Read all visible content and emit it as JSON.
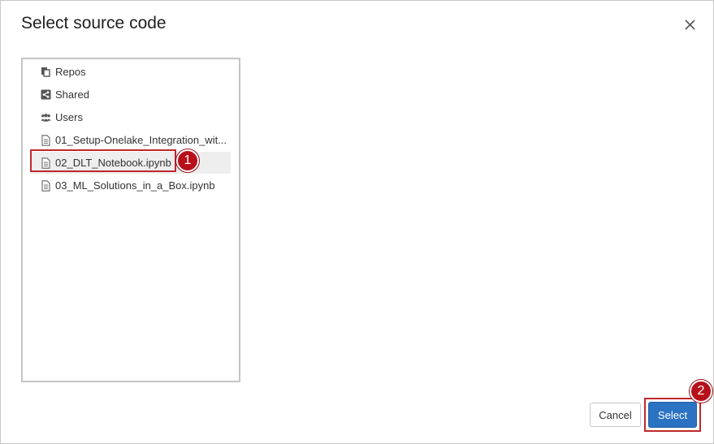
{
  "dialog": {
    "title": "Select source code",
    "close_icon": "close-icon"
  },
  "tree": {
    "items": [
      {
        "label": "Repos",
        "icon": "repos-icon"
      },
      {
        "label": "Shared",
        "icon": "shared-icon"
      },
      {
        "label": "Users",
        "icon": "users-icon"
      },
      {
        "label": "01_Setup-Onelake_Integration_wit...",
        "icon": "notebook-file-icon"
      },
      {
        "label": "02_DLT_Notebook.ipynb",
        "icon": "notebook-file-icon",
        "selected": true
      },
      {
        "label": "03_ML_Solutions_in_a_Box.ipynb",
        "icon": "notebook-file-icon"
      }
    ]
  },
  "annotations": {
    "step1": "1",
    "step2": "2",
    "color": "#b8101a"
  },
  "buttons": {
    "cancel": "Cancel",
    "select": "Select"
  },
  "colors": {
    "primary": "#2b72c2",
    "highlight": "#c0282b"
  }
}
